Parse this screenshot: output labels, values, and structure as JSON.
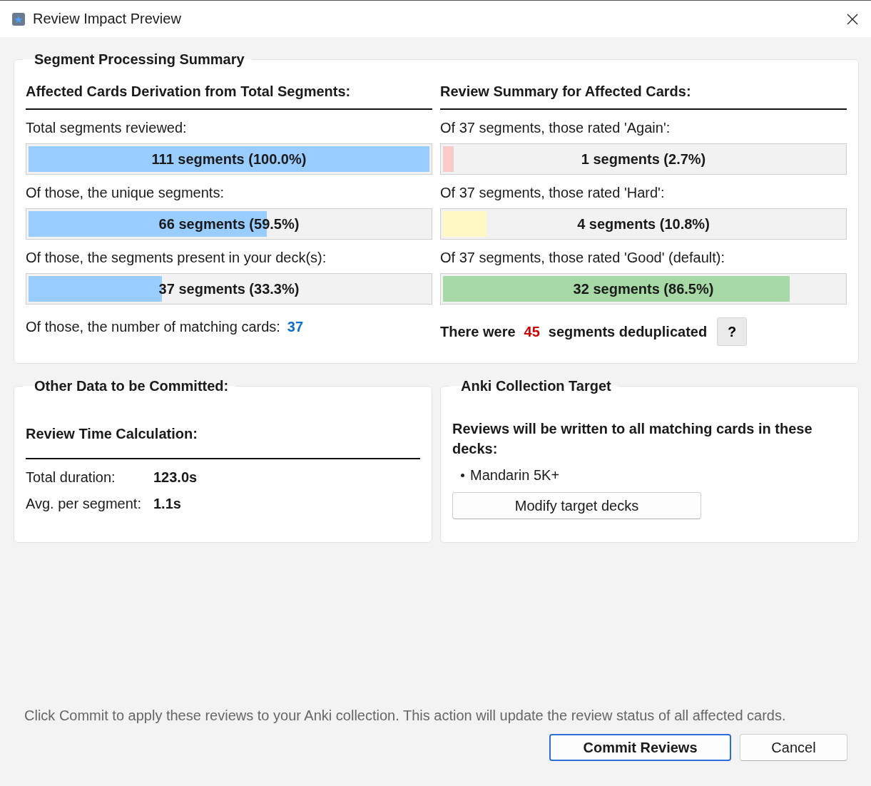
{
  "window": {
    "title": "Review Impact Preview"
  },
  "summary": {
    "title": "Segment Processing Summary",
    "left": {
      "heading": "Affected Cards Derivation from Total Segments:",
      "rows": [
        {
          "label": "Total segments reviewed:",
          "bar": "111 segments (100.0%)",
          "level": 1.0,
          "color": "#99ccff"
        },
        {
          "label": "Of those, the unique segments:",
          "bar": "66 segments (59.5%)",
          "level": 0.595,
          "color": "#99ccff"
        },
        {
          "label": "Of those, the segments present in your deck(s):",
          "bar": "37 segments (33.3%)",
          "level": 0.333,
          "color": "#99ccff"
        }
      ],
      "matching": {
        "label": "Of those, the number of matching cards:",
        "value": "37"
      }
    },
    "right": {
      "heading": "Review Summary for Affected Cards:",
      "rows": [
        {
          "label": "Of 37 segments, those rated 'Again':",
          "bar": "1 segments (2.7%)",
          "level": 0.027,
          "color": "#f8caca"
        },
        {
          "label": "Of 37 segments, those rated 'Hard':",
          "bar": "4 segments (10.8%)",
          "level": 0.108,
          "color": "#fff8c4"
        },
        {
          "label": "Of 37 segments, those rated 'Good' (default):",
          "bar": "32 segments (86.5%)",
          "level": 0.865,
          "color": "#a6d9a6"
        }
      ],
      "dedup": {
        "before": "There were",
        "count": "45",
        "after": "segments deduplicated",
        "help": "?"
      }
    }
  },
  "other": {
    "title": "Other Data to be Committed:",
    "heading": "Review Time Calculation:",
    "rows": [
      {
        "label": "Total duration:",
        "value": "123.0s"
      },
      {
        "label": "Avg. per segment:",
        "value": "1.1s"
      }
    ]
  },
  "target": {
    "title": "Anki Collection Target",
    "text": "Reviews will be written to all matching cards in these decks:",
    "decks": [
      "Mandarin 5K+"
    ],
    "button": "Modify target decks"
  },
  "footer": {
    "note": "Click Commit to apply these reviews to your Anki collection. This action will update the review status of all affected cards.",
    "buttons": [
      {
        "label": "Commit Reviews",
        "kind": "primary"
      },
      {
        "label": "Cancel",
        "kind": "secondary"
      }
    ]
  }
}
